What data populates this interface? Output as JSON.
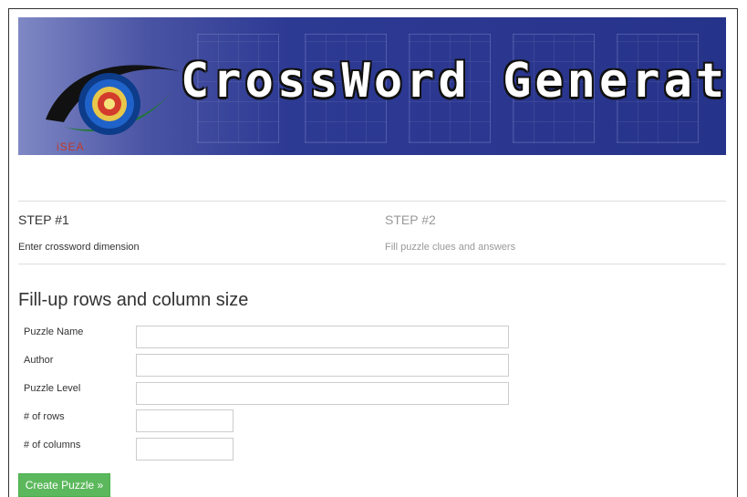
{
  "banner": {
    "title": "CrossWord Generator",
    "logo_text": "iSEA"
  },
  "steps": [
    {
      "title": "STEP #1",
      "desc": "Enter crossword dimension",
      "active": true
    },
    {
      "title": "STEP #2",
      "desc": "Fill puzzle clues and answers",
      "active": false
    }
  ],
  "form": {
    "heading": "Fill-up rows and column size",
    "fields": [
      {
        "label": "Puzzle Name",
        "value": ""
      },
      {
        "label": "Author",
        "value": ""
      },
      {
        "label": "Puzzle Level",
        "value": ""
      },
      {
        "label": "# of rows",
        "value": ""
      },
      {
        "label": "# of columns",
        "value": ""
      }
    ],
    "submit_label": "Create Puzzle »"
  },
  "colors": {
    "banner": "#2b378f",
    "submit": "#5cb85c"
  }
}
